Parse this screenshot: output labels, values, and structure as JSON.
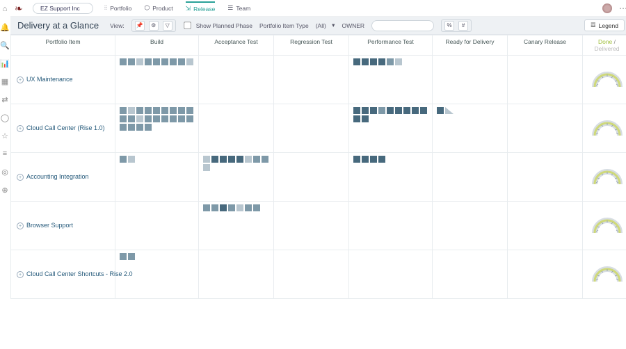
{
  "topbar": {
    "org": "EZ Support Inc",
    "tabs": [
      {
        "icon": "⫶⫶",
        "label": "Portfolio"
      },
      {
        "icon": "⬡",
        "label": "Product"
      },
      {
        "icon": "⇲",
        "label": "Release",
        "active": true
      },
      {
        "icon": "☰",
        "label": "Team"
      }
    ]
  },
  "toolbar": {
    "title": "Delivery at a Glance",
    "view_label": "View:",
    "show_phase_label": "Show Planned Phase",
    "portfolio_type_label": "Portfolio Item Type",
    "portfolio_type_value": "(All)",
    "owner_label": "OWNER",
    "owner_placeholder": "",
    "legend_label": "Legend"
  },
  "columns": [
    "Portfolio Item",
    "Build",
    "Acceptance Test",
    "Regression Test",
    "Performance Test",
    "Ready for Delivery",
    "Canary Release"
  ],
  "last_col": {
    "done": "Done",
    "sep": " / ",
    "delivered": "Delivered"
  },
  "rows": [
    {
      "name": "UX Maintenance",
      "stages": {
        "Build": [
          "m",
          "m",
          "l",
          "m",
          "m",
          "m",
          "m",
          "m",
          "l"
        ],
        "Performance Test": [
          "d",
          "d",
          "d",
          "d",
          "m",
          "l"
        ]
      }
    },
    {
      "name": "Cloud Call Center (Rise 1.0)",
      "stages": {
        "Build": [
          "m",
          "l",
          "m",
          "m",
          "m",
          "m",
          "m",
          "m",
          "m",
          "m",
          "m",
          "l",
          "m",
          "m",
          "m",
          "m",
          "m",
          "m",
          "m",
          "m",
          "m",
          "m"
        ],
        "Performance Test": [
          "d",
          "d",
          "d",
          "m",
          "d",
          "d",
          "d",
          "d",
          "d",
          "d",
          "d"
        ],
        "Ready for Delivery": [
          "d",
          "tri"
        ]
      }
    },
    {
      "name": "Accounting Integration",
      "stages": {
        "Build": [
          "m",
          "l"
        ],
        "Acceptance Test": [
          "l",
          "d",
          "d",
          "d",
          "d",
          "l",
          "m",
          "m",
          "l"
        ],
        "Performance Test": [
          "d",
          "d",
          "d",
          "d"
        ]
      }
    },
    {
      "name": "Browser Support",
      "stages": {
        "Acceptance Test": [
          "m",
          "m",
          "d",
          "m",
          "l",
          "m",
          "m"
        ]
      }
    },
    {
      "name": "Cloud Call Center Shortcuts - Rise 2.0",
      "stages": {
        "Build": [
          "m",
          "m"
        ]
      }
    }
  ],
  "rail_icons": [
    "home",
    "bell",
    "search",
    "chart",
    "grid",
    "swap",
    "globe",
    "star",
    "bars",
    "target",
    "globe2"
  ]
}
